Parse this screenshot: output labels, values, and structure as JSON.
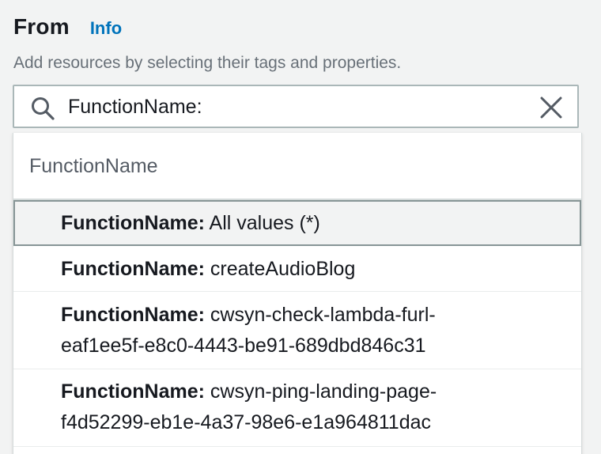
{
  "section": {
    "title": "From",
    "info_link": "Info",
    "description": "Add resources by selecting their tags and properties."
  },
  "search": {
    "value": "FunctionName:",
    "search_icon": "search-icon",
    "clear_icon": "close-icon"
  },
  "dropdown": {
    "group_label": "FunctionName",
    "options": [
      {
        "key": "FunctionName:",
        "value": "All values (*)",
        "highlighted": true
      },
      {
        "key": "FunctionName:",
        "value": "createAudioBlog",
        "highlighted": false
      },
      {
        "key": "FunctionName:",
        "value": "cwsyn-check-lambda-furl-eaf1ee5f-e8c0-4443-be91-689dbd846c31",
        "highlighted": false
      },
      {
        "key": "FunctionName:",
        "value": "cwsyn-ping-landing-page-f4d52299-eb1e-4a37-98e6-e1a964811dac",
        "highlighted": false
      }
    ]
  },
  "colors": {
    "link": "#0073bb",
    "text": "#16191f",
    "muted": "#687078",
    "border": "#aab7b8",
    "highlight_bg": "#f2f3f3"
  }
}
